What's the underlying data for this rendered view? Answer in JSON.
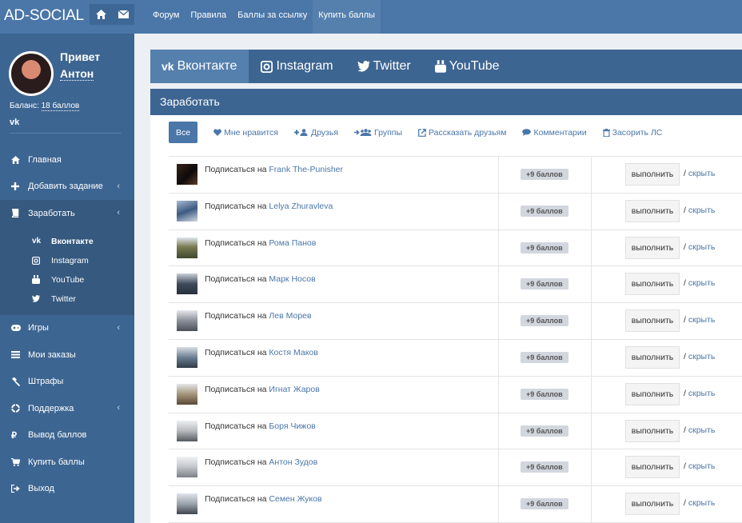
{
  "header": {
    "logo": "AD-SOCIAL",
    "menu": [
      "Форум",
      "Правила",
      "Баллы за ссылку",
      "Купить баллы"
    ]
  },
  "user": {
    "greeting": "Привет",
    "name": "Антон",
    "balance_label": "Баланс:",
    "balance_value": "18 баллов",
    "vk_mark": "vk"
  },
  "sidebar": {
    "items": [
      {
        "label": "Главная",
        "icon": "home-icon"
      },
      {
        "label": "Добавить задание",
        "icon": "plus-icon"
      },
      {
        "label": "Заработать",
        "icon": "book-icon"
      },
      {
        "label": "Игры",
        "icon": "gamepad-icon"
      },
      {
        "label": "Мои заказы",
        "icon": "list-icon"
      },
      {
        "label": "Штрафы",
        "icon": "gavel-icon"
      },
      {
        "label": "Поддержка",
        "icon": "lifebuoy-icon"
      },
      {
        "label": "Вывод баллов",
        "icon": "ruble-icon"
      },
      {
        "label": "Купить баллы",
        "icon": "cart-icon"
      },
      {
        "label": "Выход",
        "icon": "signout-icon"
      }
    ],
    "sub": [
      "Вконтакте",
      "Instagram",
      "YouTube",
      "Twitter"
    ]
  },
  "social_tabs": [
    "Вконтакте",
    "Instagram",
    "Twitter",
    "YouTube"
  ],
  "panel": {
    "title": "Заработать",
    "filters": [
      "Все",
      "Мне нравится",
      "Друзья",
      "Группы",
      "Рассказать друзьям",
      "Комментарии",
      "Засорить ЛС"
    ]
  },
  "tasks": {
    "action_prefix": "Подписаться на",
    "points": "+9 баллов",
    "do_label": "выполнить",
    "hide_sep": "/",
    "hide_label": "скрыть",
    "names": [
      "Frank The-Punisher",
      "Lelya Zhuravleva",
      "Рома Панов",
      "Марк Носов",
      "Лев Морев",
      "Костя Маков",
      "Игнат Жаров",
      "Боря Чижов",
      "Антон Зудов",
      "Семен Жуков"
    ]
  },
  "colors": {
    "brand": "#4a76a8",
    "sidebar": "#3d6591",
    "background": "#ecf0f5"
  }
}
